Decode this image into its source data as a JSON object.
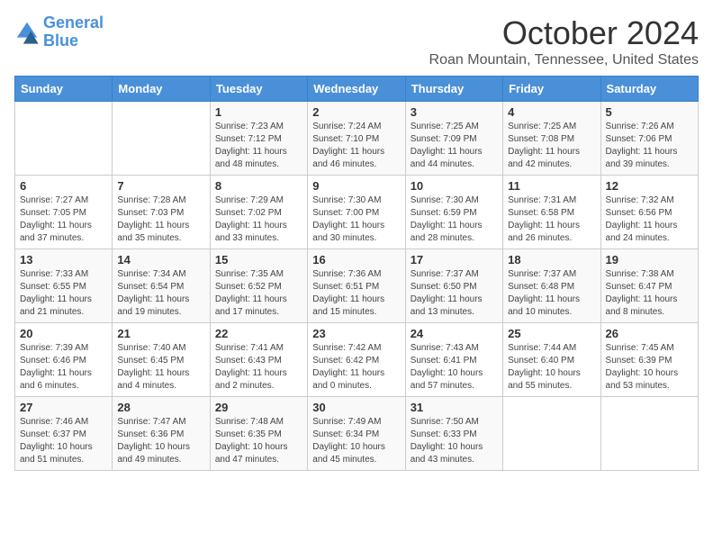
{
  "header": {
    "logo_line1": "General",
    "logo_line2": "Blue",
    "month": "October 2024",
    "location": "Roan Mountain, Tennessee, United States"
  },
  "days_of_week": [
    "Sunday",
    "Monday",
    "Tuesday",
    "Wednesday",
    "Thursday",
    "Friday",
    "Saturday"
  ],
  "weeks": [
    [
      {
        "day": "",
        "info": ""
      },
      {
        "day": "",
        "info": ""
      },
      {
        "day": "1",
        "info": "Sunrise: 7:23 AM\nSunset: 7:12 PM\nDaylight: 11 hours and 48 minutes."
      },
      {
        "day": "2",
        "info": "Sunrise: 7:24 AM\nSunset: 7:10 PM\nDaylight: 11 hours and 46 minutes."
      },
      {
        "day": "3",
        "info": "Sunrise: 7:25 AM\nSunset: 7:09 PM\nDaylight: 11 hours and 44 minutes."
      },
      {
        "day": "4",
        "info": "Sunrise: 7:25 AM\nSunset: 7:08 PM\nDaylight: 11 hours and 42 minutes."
      },
      {
        "day": "5",
        "info": "Sunrise: 7:26 AM\nSunset: 7:06 PM\nDaylight: 11 hours and 39 minutes."
      }
    ],
    [
      {
        "day": "6",
        "info": "Sunrise: 7:27 AM\nSunset: 7:05 PM\nDaylight: 11 hours and 37 minutes."
      },
      {
        "day": "7",
        "info": "Sunrise: 7:28 AM\nSunset: 7:03 PM\nDaylight: 11 hours and 35 minutes."
      },
      {
        "day": "8",
        "info": "Sunrise: 7:29 AM\nSunset: 7:02 PM\nDaylight: 11 hours and 33 minutes."
      },
      {
        "day": "9",
        "info": "Sunrise: 7:30 AM\nSunset: 7:00 PM\nDaylight: 11 hours and 30 minutes."
      },
      {
        "day": "10",
        "info": "Sunrise: 7:30 AM\nSunset: 6:59 PM\nDaylight: 11 hours and 28 minutes."
      },
      {
        "day": "11",
        "info": "Sunrise: 7:31 AM\nSunset: 6:58 PM\nDaylight: 11 hours and 26 minutes."
      },
      {
        "day": "12",
        "info": "Sunrise: 7:32 AM\nSunset: 6:56 PM\nDaylight: 11 hours and 24 minutes."
      }
    ],
    [
      {
        "day": "13",
        "info": "Sunrise: 7:33 AM\nSunset: 6:55 PM\nDaylight: 11 hours and 21 minutes."
      },
      {
        "day": "14",
        "info": "Sunrise: 7:34 AM\nSunset: 6:54 PM\nDaylight: 11 hours and 19 minutes."
      },
      {
        "day": "15",
        "info": "Sunrise: 7:35 AM\nSunset: 6:52 PM\nDaylight: 11 hours and 17 minutes."
      },
      {
        "day": "16",
        "info": "Sunrise: 7:36 AM\nSunset: 6:51 PM\nDaylight: 11 hours and 15 minutes."
      },
      {
        "day": "17",
        "info": "Sunrise: 7:37 AM\nSunset: 6:50 PM\nDaylight: 11 hours and 13 minutes."
      },
      {
        "day": "18",
        "info": "Sunrise: 7:37 AM\nSunset: 6:48 PM\nDaylight: 11 hours and 10 minutes."
      },
      {
        "day": "19",
        "info": "Sunrise: 7:38 AM\nSunset: 6:47 PM\nDaylight: 11 hours and 8 minutes."
      }
    ],
    [
      {
        "day": "20",
        "info": "Sunrise: 7:39 AM\nSunset: 6:46 PM\nDaylight: 11 hours and 6 minutes."
      },
      {
        "day": "21",
        "info": "Sunrise: 7:40 AM\nSunset: 6:45 PM\nDaylight: 11 hours and 4 minutes."
      },
      {
        "day": "22",
        "info": "Sunrise: 7:41 AM\nSunset: 6:43 PM\nDaylight: 11 hours and 2 minutes."
      },
      {
        "day": "23",
        "info": "Sunrise: 7:42 AM\nSunset: 6:42 PM\nDaylight: 11 hours and 0 minutes."
      },
      {
        "day": "24",
        "info": "Sunrise: 7:43 AM\nSunset: 6:41 PM\nDaylight: 10 hours and 57 minutes."
      },
      {
        "day": "25",
        "info": "Sunrise: 7:44 AM\nSunset: 6:40 PM\nDaylight: 10 hours and 55 minutes."
      },
      {
        "day": "26",
        "info": "Sunrise: 7:45 AM\nSunset: 6:39 PM\nDaylight: 10 hours and 53 minutes."
      }
    ],
    [
      {
        "day": "27",
        "info": "Sunrise: 7:46 AM\nSunset: 6:37 PM\nDaylight: 10 hours and 51 minutes."
      },
      {
        "day": "28",
        "info": "Sunrise: 7:47 AM\nSunset: 6:36 PM\nDaylight: 10 hours and 49 minutes."
      },
      {
        "day": "29",
        "info": "Sunrise: 7:48 AM\nSunset: 6:35 PM\nDaylight: 10 hours and 47 minutes."
      },
      {
        "day": "30",
        "info": "Sunrise: 7:49 AM\nSunset: 6:34 PM\nDaylight: 10 hours and 45 minutes."
      },
      {
        "day": "31",
        "info": "Sunrise: 7:50 AM\nSunset: 6:33 PM\nDaylight: 10 hours and 43 minutes."
      },
      {
        "day": "",
        "info": ""
      },
      {
        "day": "",
        "info": ""
      }
    ]
  ]
}
